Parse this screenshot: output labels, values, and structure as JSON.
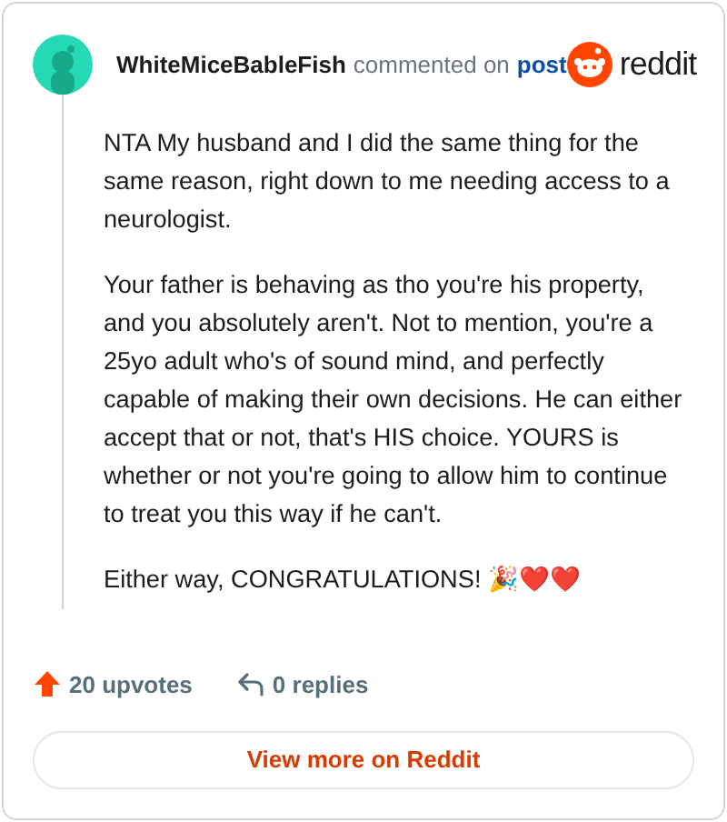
{
  "header": {
    "username": "WhiteMiceBableFish",
    "action": "commented on",
    "link": "post",
    "brand": "reddit"
  },
  "paragraphs": [
    "NTA My husband and I did the same thing for the same reason, right down to me needing access to a neurologist.",
    "Your father is behaving as tho you're his property, and you absolutely aren't. Not to mention, you're a 25yo adult who's of sound mind, and perfectly capable of making their own decisions. He can either accept that or not, that's HIS choice. YOURS is whether or not you're going to allow him to continue to treat you this way if he can't.",
    "Either way, CONGRATULATIONS! 🎉❤️❤️"
  ],
  "footer": {
    "upvotes": "20 upvotes",
    "replies": "0 replies"
  },
  "button": "View more on Reddit"
}
